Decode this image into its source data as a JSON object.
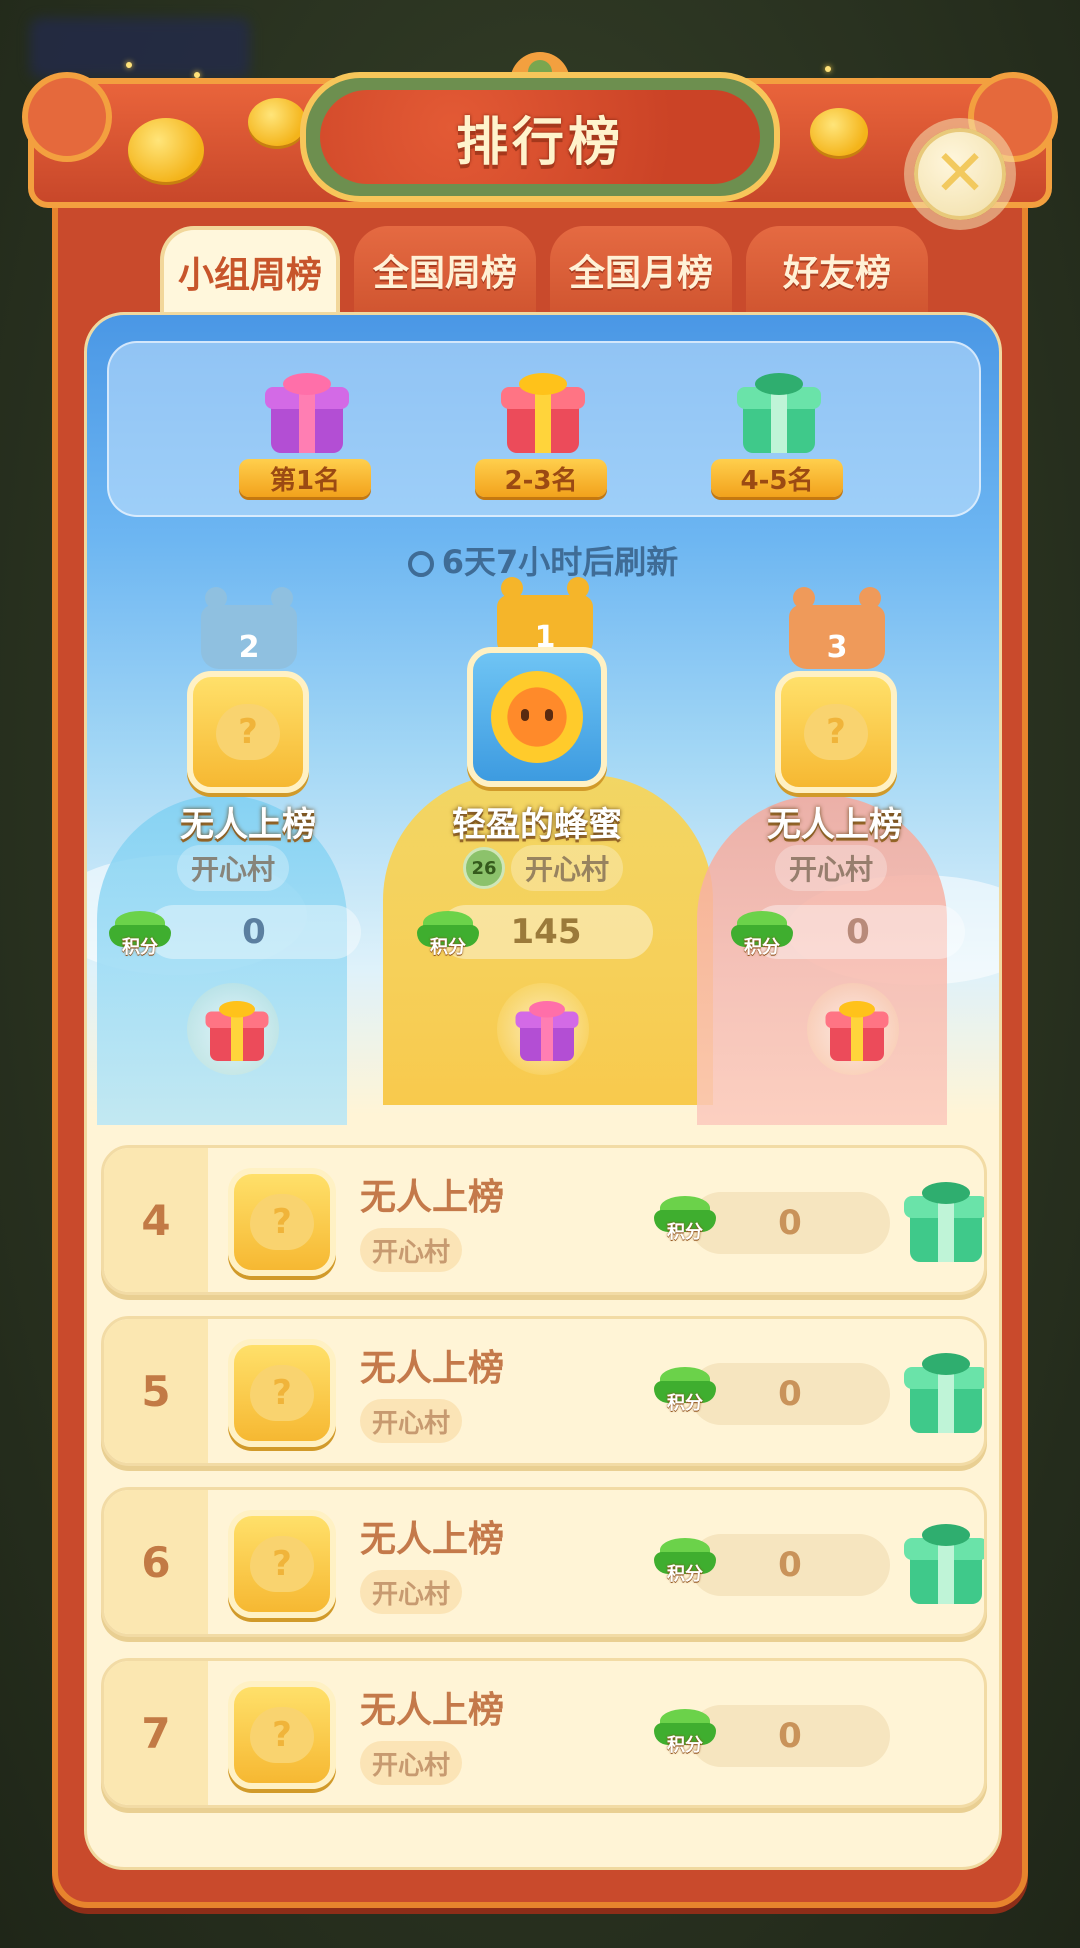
{
  "header": {
    "title": "排行榜",
    "close_symbol": "✕"
  },
  "tabs": [
    {
      "label": "小组周榜",
      "active": true
    },
    {
      "label": "全国周榜",
      "active": false
    },
    {
      "label": "全国月榜",
      "active": false
    },
    {
      "label": "好友榜",
      "active": false
    }
  ],
  "rewards": [
    {
      "label": "第1名",
      "gift": "purple-gift-icon"
    },
    {
      "label": "2-3名",
      "gift": "red-gift-icon"
    },
    {
      "label": "4-5名",
      "gift": "green-gift-icon"
    }
  ],
  "refresh_text": "6天7小时后刷新",
  "podium": [
    {
      "rank": "2",
      "name": "无人上榜",
      "village": "开心村",
      "score": "0",
      "score_unit": "积分"
    },
    {
      "rank": "1",
      "name": "轻盈的蜂蜜",
      "village": "开心村",
      "level": "26",
      "score": "145",
      "score_unit": "积分"
    },
    {
      "rank": "3",
      "name": "无人上榜",
      "village": "开心村",
      "score": "0",
      "score_unit": "积分"
    }
  ],
  "list": [
    {
      "rank": "4",
      "name": "无人上榜",
      "village": "开心村",
      "score": "0",
      "score_unit": "积分",
      "has_gift": true
    },
    {
      "rank": "5",
      "name": "无人上榜",
      "village": "开心村",
      "score": "0",
      "score_unit": "积分",
      "has_gift": true
    },
    {
      "rank": "6",
      "name": "无人上榜",
      "village": "开心村",
      "score": "0",
      "score_unit": "积分",
      "has_gift": true
    },
    {
      "rank": "7",
      "name": "无人上榜",
      "village": "开心村",
      "score": "0",
      "score_unit": "积分",
      "has_gift": false
    }
  ],
  "colors": {
    "frame": "#c94a2c",
    "frame_border": "#e7842d",
    "panel": "#fff4d6",
    "gold": "#f6b832",
    "sky": "#4a97e5"
  },
  "placeholder_symbol": "?"
}
